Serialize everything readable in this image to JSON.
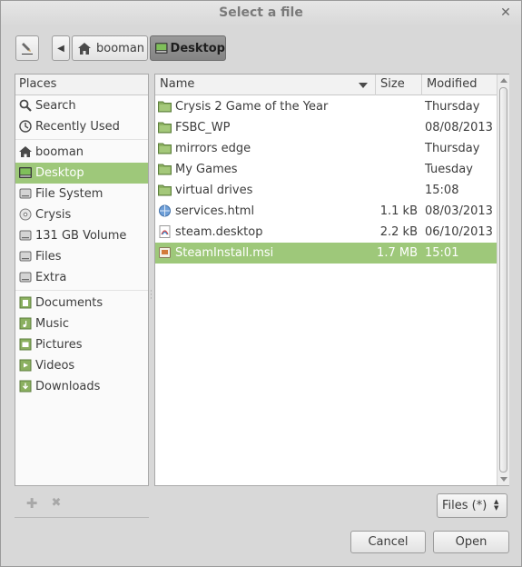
{
  "window": {
    "title": "Select a file"
  },
  "pathbar": {
    "crumbs": [
      {
        "label": "booman",
        "icon": "home-icon"
      },
      {
        "label": "Desktop",
        "icon": "desktop-icon",
        "active": true
      }
    ]
  },
  "places": {
    "header": "Places",
    "items": [
      {
        "label": "Search",
        "icon": "search-icon"
      },
      {
        "label": "Recently Used",
        "icon": "recent-icon"
      },
      {
        "label": "booman",
        "icon": "home-icon"
      },
      {
        "label": "Desktop",
        "icon": "desktop-icon",
        "selected": true
      },
      {
        "label": "File System",
        "icon": "drive-icon"
      },
      {
        "label": "Crysis",
        "icon": "disc-icon"
      },
      {
        "label": "131 GB Volume",
        "icon": "drive-icon"
      },
      {
        "label": "Files",
        "icon": "drive-icon"
      },
      {
        "label": "Extra",
        "icon": "drive-icon"
      },
      {
        "label": "Documents",
        "icon": "folder-documents-icon"
      },
      {
        "label": "Music",
        "icon": "folder-music-icon"
      },
      {
        "label": "Pictures",
        "icon": "folder-pictures-icon"
      },
      {
        "label": "Videos",
        "icon": "folder-videos-icon"
      },
      {
        "label": "Downloads",
        "icon": "folder-downloads-icon"
      }
    ]
  },
  "files": {
    "columns": {
      "name": "Name",
      "size": "Size",
      "modified": "Modified"
    },
    "rows": [
      {
        "name": "Crysis 2 Game of the Year",
        "size": "",
        "modified": "Thursday",
        "icon": "folder-icon"
      },
      {
        "name": "FSBC_WP",
        "size": "",
        "modified": "08/08/2013",
        "icon": "folder-icon"
      },
      {
        "name": "mirrors edge",
        "size": "",
        "modified": "Thursday",
        "icon": "folder-icon"
      },
      {
        "name": "My Games",
        "size": "",
        "modified": "Tuesday",
        "icon": "folder-icon"
      },
      {
        "name": "virtual drives",
        "size": "",
        "modified": "15:08",
        "icon": "folder-icon"
      },
      {
        "name": "services.html",
        "size": "1.1 kB",
        "modified": "08/03/2013",
        "icon": "html-file-icon"
      },
      {
        "name": "steam.desktop",
        "size": "2.2 kB",
        "modified": "06/10/2013",
        "icon": "desktop-file-icon"
      },
      {
        "name": "SteamInstall.msi",
        "size": "1.7 MB",
        "modified": "15:01",
        "icon": "msi-file-icon",
        "selected": true
      }
    ]
  },
  "filter": {
    "selected": "Files (*)"
  },
  "buttons": {
    "cancel": "Cancel",
    "open": "Open"
  },
  "colors": {
    "selection": "#9ec87a",
    "folder": "#8bb060"
  }
}
